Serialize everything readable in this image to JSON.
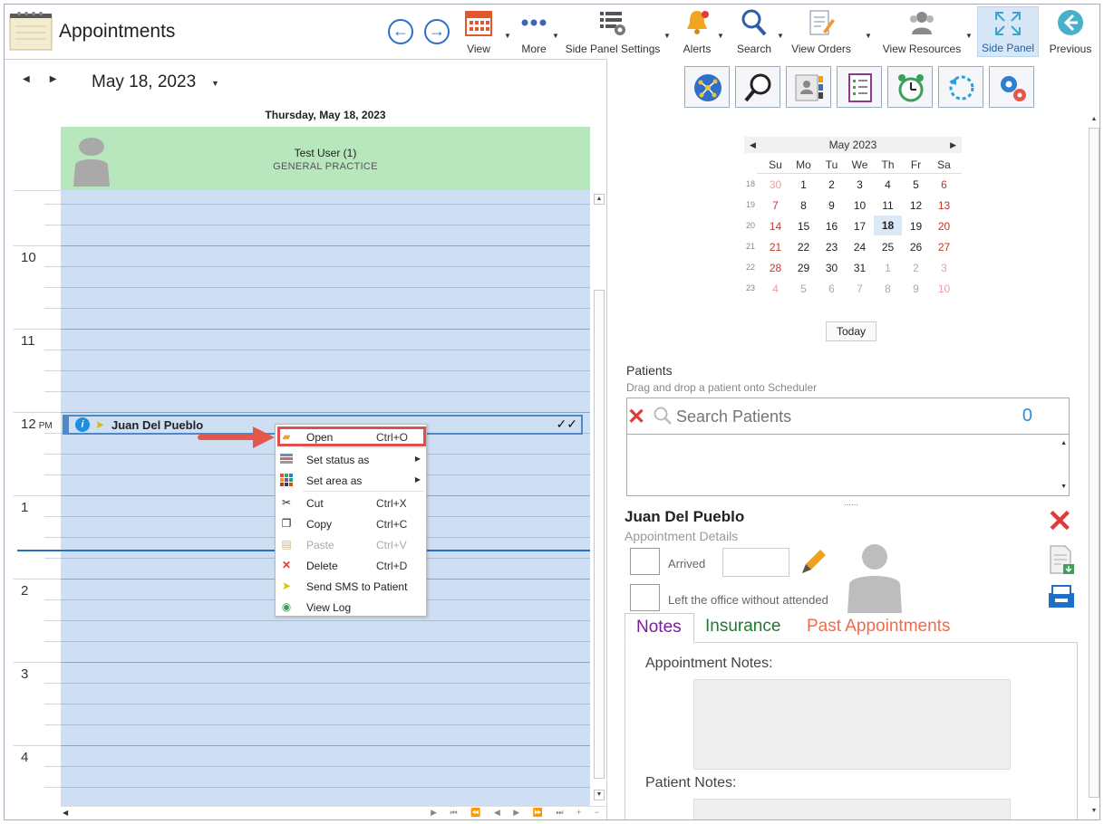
{
  "header": {
    "title": "Appointments",
    "buttons": [
      {
        "label": "View",
        "icon": "calendar-icon"
      },
      {
        "label": "More",
        "icon": "more-dots-icon"
      },
      {
        "label": "Side Panel Settings",
        "icon": "panel-settings-icon"
      },
      {
        "label": "Alerts",
        "icon": "bell-icon"
      },
      {
        "label": "Search",
        "icon": "search-icon"
      },
      {
        "label": "View Orders",
        "icon": "orders-icon"
      },
      {
        "label": "View Resources",
        "icon": "resources-icon"
      },
      {
        "label": "Side Panel",
        "icon": "expand-icon"
      },
      {
        "label": "Previous",
        "icon": "previous-icon"
      }
    ]
  },
  "scheduler": {
    "date": "May 18, 2023",
    "day_header": "Thursday, May 18, 2023",
    "resource_name": "Test User (1)",
    "resource_subtitle": "GENERAL PRACTICE",
    "hours": [
      {
        "label": "10",
        "suffix": ""
      },
      {
        "label": "11",
        "suffix": ""
      },
      {
        "label": "12",
        "suffix": "PM"
      },
      {
        "label": "1",
        "suffix": ""
      },
      {
        "label": "2",
        "suffix": ""
      },
      {
        "label": "3",
        "suffix": ""
      },
      {
        "label": "4",
        "suffix": ""
      }
    ],
    "appointment": {
      "patient": "Juan Del Pueblo",
      "info_glyph": "i",
      "status": "✓✓"
    }
  },
  "context_menu": {
    "items": [
      {
        "label": "Open",
        "shortcut": "Ctrl+O",
        "icon": "folder-open-icon",
        "highlighted": true
      },
      {
        "label": "Set status as",
        "shortcut": "",
        "icon": "status-icon",
        "submenu": true
      },
      {
        "label": "Set area as",
        "shortcut": "",
        "icon": "area-icon",
        "submenu": true
      },
      {
        "label": "Cut",
        "shortcut": "Ctrl+X",
        "icon": "scissors-icon"
      },
      {
        "label": "Copy",
        "shortcut": "Ctrl+C",
        "icon": "copy-icon"
      },
      {
        "label": "Paste",
        "shortcut": "Ctrl+V",
        "icon": "paste-icon",
        "disabled": true
      },
      {
        "label": "Delete",
        "shortcut": "Ctrl+D",
        "icon": "delete-x-icon"
      },
      {
        "label": "Send SMS to Patient",
        "shortcut": "",
        "icon": "send-icon"
      },
      {
        "label": "View Log",
        "shortcut": "",
        "icon": "log-icon"
      }
    ]
  },
  "side_panel": {
    "icons": [
      "network-icon",
      "magnifier-icon",
      "contact-card-icon",
      "checklist-icon",
      "alarm-clock-icon",
      "refresh-icon",
      "settings-gears-icon"
    ],
    "mini_calendar": {
      "month": "May 2023",
      "weekdays": [
        "Su",
        "Mo",
        "Tu",
        "We",
        "Th",
        "Fr",
        "Sa"
      ],
      "weeks": [
        {
          "wk": "18",
          "days": [
            "30",
            "1",
            "2",
            "3",
            "4",
            "5",
            "6"
          ]
        },
        {
          "wk": "19",
          "days": [
            "7",
            "8",
            "9",
            "10",
            "11",
            "12",
            "13"
          ]
        },
        {
          "wk": "20",
          "days": [
            "14",
            "15",
            "16",
            "17",
            "18",
            "19",
            "20"
          ]
        },
        {
          "wk": "21",
          "days": [
            "21",
            "22",
            "23",
            "24",
            "25",
            "26",
            "27"
          ]
        },
        {
          "wk": "22",
          "days": [
            "28",
            "29",
            "30",
            "31",
            "1",
            "2",
            "3"
          ]
        },
        {
          "wk": "23",
          "days": [
            "4",
            "5",
            "6",
            "7",
            "8",
            "9",
            "10"
          ]
        }
      ],
      "selected": "18",
      "today_label": "Today"
    },
    "patients": {
      "title": "Patients",
      "subtitle": "Drag and drop a patient onto Scheduler",
      "search_placeholder": "Search Patients",
      "count": "0"
    },
    "details": {
      "name": "Juan Del Pueblo",
      "subtitle": "Appointment Details",
      "arrived_label": "Arrived",
      "left_label": "Left the office without attended"
    },
    "tabs": [
      {
        "label": "Notes",
        "color": "#7a1e9e"
      },
      {
        "label": "Insurance",
        "color": "#1f7a2e"
      },
      {
        "label": "Past Appointments",
        "color": "#ef6b4f"
      }
    ],
    "appointment_notes_label": "Appointment Notes:",
    "patient_notes_label": "Patient Notes:"
  },
  "colors": {
    "accent": "#2f6fc8",
    "resource_bg": "#b8e6bd",
    "grid_bg": "#cfdff3",
    "highlight_red": "#e04f4f"
  }
}
